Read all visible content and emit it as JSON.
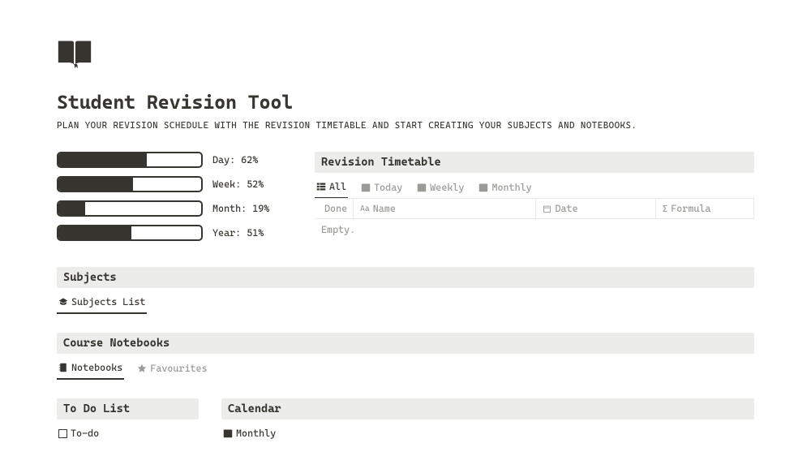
{
  "page": {
    "title": "Student Revision Tool",
    "subtitle": "PLAN YOUR REVISION SCHEDULE WITH THE REVISION TIMETABLE AND START CREATING YOUR SUBJECTS AND NOTEBOOKS."
  },
  "progress": [
    {
      "label": "Day: 62%",
      "pct": 62
    },
    {
      "label": "Week: 52%",
      "pct": 52
    },
    {
      "label": "Month: 19%",
      "pct": 19
    },
    {
      "label": "Year: 51%",
      "pct": 51
    }
  ],
  "timetable": {
    "header": "Revision Timetable",
    "tabs": [
      "All",
      "Today",
      "Weekly",
      "Monthly"
    ],
    "cols": {
      "done": "Done",
      "name": "Name",
      "date": "Date",
      "formula": "Formula"
    },
    "empty": "Empty."
  },
  "subjects": {
    "header": "Subjects",
    "tab": "Subjects List"
  },
  "notebooks": {
    "header": "Course Notebooks",
    "tabs": [
      "Notebooks",
      "Favourites"
    ]
  },
  "todolist": {
    "header": "To Do List",
    "tab": "To-do"
  },
  "calendar": {
    "header": "Calendar",
    "tab": "Monthly"
  }
}
